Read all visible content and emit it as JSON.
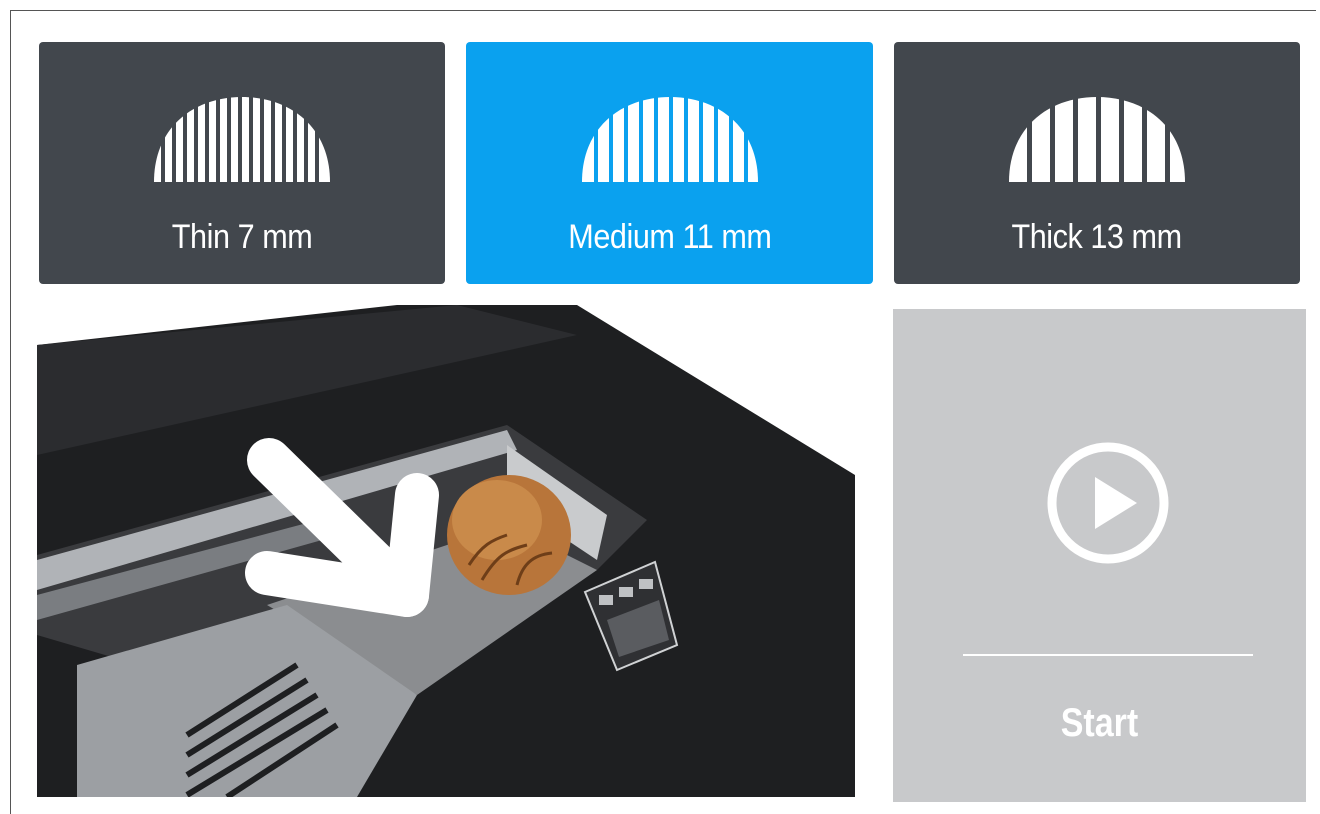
{
  "slice_options": [
    {
      "label": "Thin 7 mm",
      "selected": false,
      "icon": "bread-thin-slices-icon"
    },
    {
      "label": "Medium 11 mm",
      "selected": true,
      "icon": "bread-medium-slices-icon"
    },
    {
      "label": "Thick 13 mm",
      "selected": false,
      "icon": "bread-thick-slices-icon"
    }
  ],
  "start": {
    "label": "Start",
    "icon": "play-circle-icon"
  },
  "colors": {
    "button_default": "#42474d",
    "button_selected": "#0aa1ef",
    "start_panel": "#c8c9cb"
  }
}
